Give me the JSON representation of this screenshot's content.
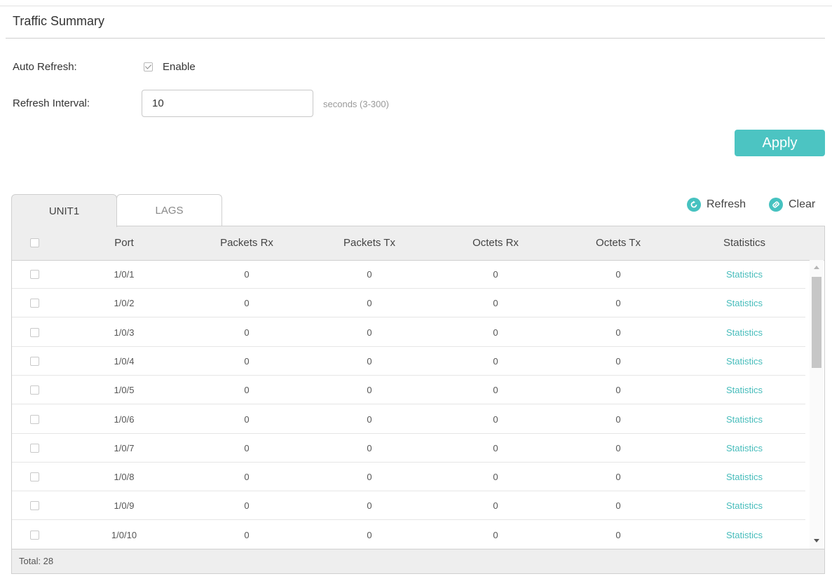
{
  "section": {
    "title": "Traffic Summary"
  },
  "auto_refresh": {
    "label": "Auto Refresh:",
    "checkbox_label": "Enable",
    "checked": true
  },
  "refresh_interval": {
    "label": "Refresh Interval:",
    "value": "10",
    "hint": "seconds (3-300)"
  },
  "apply_label": "Apply",
  "tabs": [
    {
      "label": "UNIT1",
      "active": true
    },
    {
      "label": "LAGS",
      "active": false
    }
  ],
  "actions": {
    "refresh_label": "Refresh",
    "clear_label": "Clear",
    "icon_color": "#46c2c0"
  },
  "table": {
    "columns": [
      "Port",
      "Packets Rx",
      "Packets Tx",
      "Octets Rx",
      "Octets Tx",
      "Statistics"
    ],
    "rows": [
      {
        "port": "1/0/1",
        "packets_rx": "0",
        "packets_tx": "0",
        "octets_rx": "0",
        "octets_tx": "0",
        "statistics": "Statistics"
      },
      {
        "port": "1/0/2",
        "packets_rx": "0",
        "packets_tx": "0",
        "octets_rx": "0",
        "octets_tx": "0",
        "statistics": "Statistics"
      },
      {
        "port": "1/0/3",
        "packets_rx": "0",
        "packets_tx": "0",
        "octets_rx": "0",
        "octets_tx": "0",
        "statistics": "Statistics"
      },
      {
        "port": "1/0/4",
        "packets_rx": "0",
        "packets_tx": "0",
        "octets_rx": "0",
        "octets_tx": "0",
        "statistics": "Statistics"
      },
      {
        "port": "1/0/5",
        "packets_rx": "0",
        "packets_tx": "0",
        "octets_rx": "0",
        "octets_tx": "0",
        "statistics": "Statistics"
      },
      {
        "port": "1/0/6",
        "packets_rx": "0",
        "packets_tx": "0",
        "octets_rx": "0",
        "octets_tx": "0",
        "statistics": "Statistics"
      },
      {
        "port": "1/0/7",
        "packets_rx": "0",
        "packets_tx": "0",
        "octets_rx": "0",
        "octets_tx": "0",
        "statistics": "Statistics"
      },
      {
        "port": "1/0/8",
        "packets_rx": "0",
        "packets_tx": "0",
        "octets_rx": "0",
        "octets_tx": "0",
        "statistics": "Statistics"
      },
      {
        "port": "1/0/9",
        "packets_rx": "0",
        "packets_tx": "0",
        "octets_rx": "0",
        "octets_tx": "0",
        "statistics": "Statistics"
      },
      {
        "port": "1/0/10",
        "packets_rx": "0",
        "packets_tx": "0",
        "octets_rx": "0",
        "octets_tx": "0",
        "statistics": "Statistics"
      }
    ],
    "total_label": "Total: 28"
  },
  "colors": {
    "accent": "#4cc4c2",
    "link": "#46bcbb",
    "header_bg": "#eeeeee"
  }
}
